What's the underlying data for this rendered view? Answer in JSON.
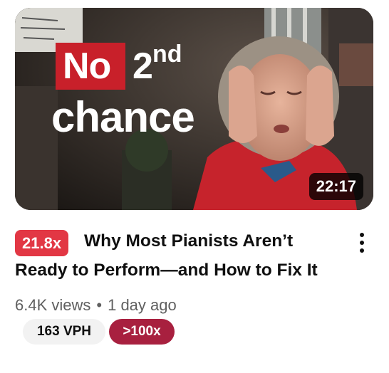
{
  "thumbnail": {
    "overlay_line1_word": "No",
    "overlay_line1_number": "2",
    "overlay_line1_suffix": "nd",
    "overlay_line2": "chance",
    "duration": "22:17",
    "accent_color": "#c8202a"
  },
  "video": {
    "outlier_badge": "21.8x",
    "title": "Why Most Pianists Aren’t Ready to Perform—and How to Fix It",
    "views": "6.4K views",
    "separator": "•",
    "age": "1 day ago"
  },
  "stats": {
    "vph": "163 VPH",
    "ratio": ">100x"
  },
  "menu": {
    "icon": "more-vert-icon"
  }
}
